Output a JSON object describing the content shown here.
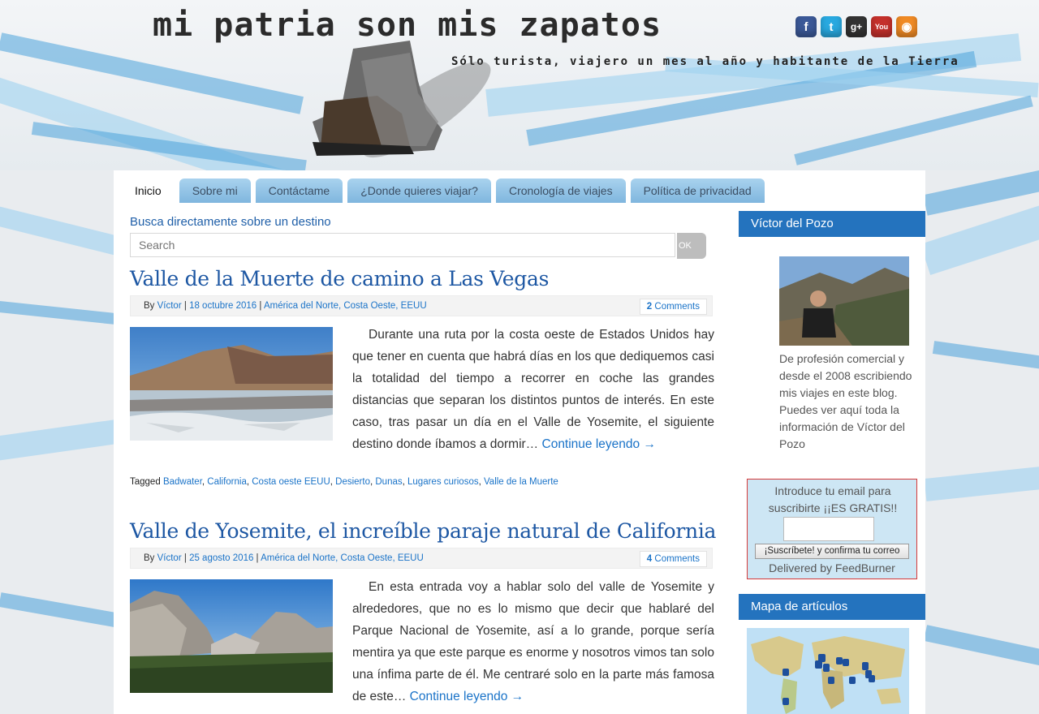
{
  "header": {
    "logo_text": "mi patria son mis zapatos",
    "tagline": "Sólo turista, viajero un mes al año y habitante de la Tierra",
    "social": [
      {
        "name": "facebook",
        "glyph": "f",
        "color": "#3b5998"
      },
      {
        "name": "twitter",
        "glyph": "t",
        "color": "#29a9e0"
      },
      {
        "name": "google-plus",
        "glyph": "g+",
        "color": "#333333"
      },
      {
        "name": "youtube",
        "glyph": "You",
        "color": "#c4302b"
      },
      {
        "name": "rss",
        "glyph": "◉",
        "color": "#f08a24"
      }
    ]
  },
  "nav": {
    "tabs": [
      "Inicio",
      "Sobre mi",
      "Contáctame",
      "¿Donde quieres viajar?",
      "Cronología de viajes",
      "Política de privacidad"
    ]
  },
  "search": {
    "label": "Busca directamente sobre un destino",
    "placeholder": "Search",
    "button": "OK"
  },
  "posts": [
    {
      "title": "Valle de la Muerte de camino a Las Vegas",
      "by": "By",
      "author": "Víctor",
      "date": "18 octubre 2016",
      "categories": "América del Norte, Costa Oeste, EEUU",
      "comments_count": "2",
      "comments_label": "Comments",
      "excerpt": "Durante una ruta por la costa oeste de Estados Unidos hay que tener en cuenta que habrá días en los que dediquemos casi la totalidad del tiempo a recorrer en coche las grandes distancias que separan los distintos puntos de interés. En este caso, tras pasar un día en el Valle de Yosemite, el siguiente destino donde íbamos a dormir…",
      "read_more": "Continue leyendo →",
      "tagged_label": "Tagged",
      "tags": [
        "Badwater",
        "California",
        "Costa oeste EEUU",
        "Desierto",
        "Dunas",
        "Lugares curiosos",
        "Valle de la Muerte"
      ]
    },
    {
      "title": "Valle de Yosemite, el increíble paraje natural de California",
      "by": "By",
      "author": "Víctor",
      "date": "25 agosto 2016",
      "categories": "América del Norte, Costa Oeste, EEUU",
      "comments_count": "4",
      "comments_label": "Comments",
      "excerpt": "En esta entrada voy a hablar solo del valle de Yosemite y alrededores, que no es lo mismo que decir que hablaré del Parque Nacional de Yosemite, así a lo grande, porque sería mentira ya que este parque es enorme y nosotros vimos tan solo una ínfima parte de él. Me centraré solo en la parte más famosa de este…",
      "read_more": "Continue leyendo →"
    }
  ],
  "sidebar": {
    "profile_title": "Víctor del Pozo",
    "bio_text": "De profesión comercial y desde el 2008 escribiendo mis viajes en este blog. Puedes ver",
    "bio_link": "aquí",
    "bio_text2": "toda la información de",
    "bio_link2": "Víctor del Pozo",
    "subscribe_text": "Introduce tu email para suscribirte ¡¡ES GRATIS!!",
    "subscribe_button": "¡Suscríbete! y confirma tu correo",
    "delivered_by": "Delivered by",
    "feedburner": "FeedBurner",
    "map_title": "Mapa de artículos"
  }
}
